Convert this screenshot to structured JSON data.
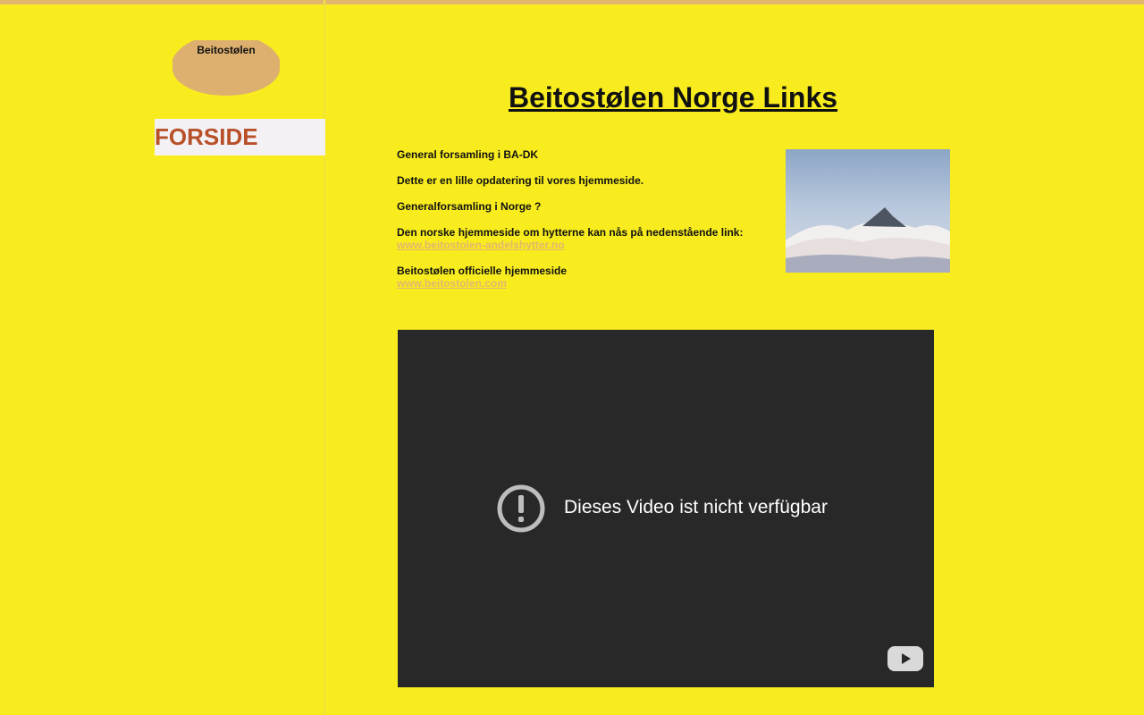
{
  "site": {
    "logo_text": "Beitostølen"
  },
  "nav": {
    "items": [
      {
        "label": "FORSIDE"
      }
    ]
  },
  "main": {
    "title": "Beitostølen Norge Links",
    "paragraphs": [
      {
        "text": "General forsamling i BA-DK"
      },
      {
        "text": "Dette er en lille opdatering til vores hjemmeside."
      },
      {
        "text": "Generalforsamling i Norge ?"
      },
      {
        "text": "Den norske hjemmeside om hytterne kan nås på nedenstående link:",
        "link": "www.beitostolen-andelshytter.no"
      },
      {
        "text": "Beitostølen officielle hjemmeside",
        "link": "www.beitostolen.com"
      }
    ]
  },
  "video": {
    "message": "Dieses Video ist nicht verfügbar",
    "status_icon": "alert-circle-icon",
    "logo_icon": "youtube-play-icon"
  },
  "colors": {
    "background": "#f8ec1f",
    "accent": "#e3b66e",
    "nav_text": "#b8502a"
  }
}
